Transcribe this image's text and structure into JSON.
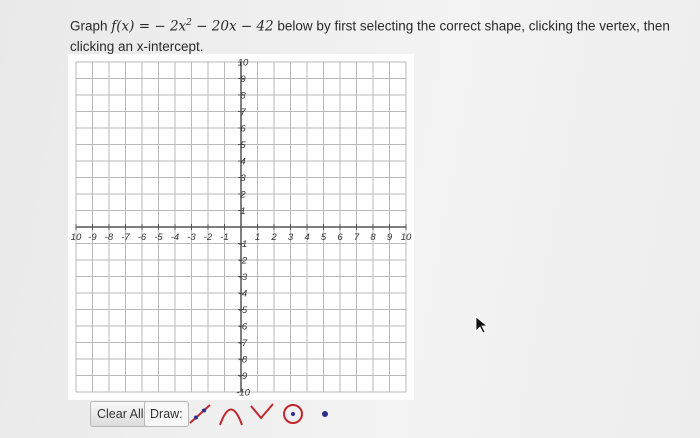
{
  "question": {
    "prefix": "Graph ",
    "function_lhs": "f(x)",
    "eq": " = ",
    "term1_coef": "− 2x",
    "term1_exp": "2",
    "term2": " − 20x − 42",
    "suffix": " below by first selecting the correct shape, clicking the vertex, then clicking an x-intercept."
  },
  "graph": {
    "x_ticks": [
      "10",
      "-9",
      "-8",
      "-7",
      "-6",
      "-5",
      "-4",
      "-3",
      "-2",
      "-1",
      "1",
      "2",
      "3",
      "4",
      "5",
      "6",
      "7",
      "8",
      "9",
      "10"
    ],
    "y_ticks": [
      "10",
      "9",
      "8",
      "7",
      "6",
      "5",
      "4",
      "3",
      "2",
      "1",
      "-1",
      "-2",
      "-3",
      "-4",
      "-5",
      "-6",
      "-7",
      "-8",
      "-9",
      "-10"
    ],
    "x_tick_values": [
      -10,
      -9,
      -8,
      -7,
      -6,
      -5,
      -4,
      -3,
      -2,
      -1,
      1,
      2,
      3,
      4,
      5,
      6,
      7,
      8,
      9,
      10
    ],
    "y_tick_values": [
      10,
      9,
      8,
      7,
      6,
      5,
      4,
      3,
      2,
      1,
      -1,
      -2,
      -3,
      -4,
      -5,
      -6,
      -7,
      -8,
      -9,
      -10
    ],
    "xlim": [
      -10,
      10
    ],
    "ylim": [
      -10,
      10
    ],
    "grid": true
  },
  "toolbar": {
    "clear_label": "Clear All",
    "draw_label": "Draw:",
    "tools": [
      "line-tool-icon",
      "parabola-down-icon",
      "parabola-up-icon",
      "circle-icon",
      "point-icon"
    ]
  },
  "colors": {
    "grid": "#b9b9b9",
    "axis": "#555555",
    "tool_accent": "#c2272d"
  }
}
